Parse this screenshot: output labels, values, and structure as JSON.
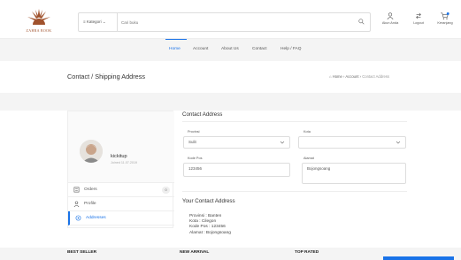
{
  "brand": {
    "name": "ZAHRA BOOK"
  },
  "search": {
    "category": "Kategori",
    "placeholder": "Cari buku"
  },
  "header_tools": [
    {
      "label": "Akun Anda",
      "icon": "user-icon"
    },
    {
      "label": "Logout",
      "icon": "logout-icon"
    },
    {
      "label": "Keranjang",
      "icon": "cart-icon",
      "badge_color": "#1a73e8"
    }
  ],
  "nav": [
    "Home",
    "Account",
    "About Us",
    "Contact",
    "Help / FAQ"
  ],
  "page": {
    "title": "Contact / Shipping Address",
    "breadcrumb": [
      "Home",
      "Account",
      "Contact Address"
    ]
  },
  "user": {
    "name": "kickitup",
    "joined": "Joined 11.07.2019"
  },
  "sidebar": [
    {
      "label": "Orders",
      "icon": "orders-icon",
      "count": "0"
    },
    {
      "label": "Profile",
      "icon": "profile-icon"
    },
    {
      "label": "Addresses",
      "icon": "address-icon",
      "active": true
    }
  ],
  "form": {
    "title": "Contact Address",
    "province_label": "Provinsi",
    "province_value": "Sulit",
    "city_label": "Kota",
    "city_value": "",
    "zip_label": "Kode Pos",
    "zip_value": "123456",
    "address_label": "Alamat",
    "address_value": "Bojongsoang"
  },
  "your_address": {
    "title": "Your Contact Address",
    "lines": [
      "Provinsi : Banten",
      "Kota :     Cilegon",
      "Kode Pos : 123456",
      "Alamat : Bojongsoang"
    ]
  },
  "footer": [
    "BEST SELLER",
    "NEW ARRIVAL",
    "TOP RATED"
  ],
  "colors": {
    "accent": "#1a73e8",
    "logo": "#a0522d"
  }
}
